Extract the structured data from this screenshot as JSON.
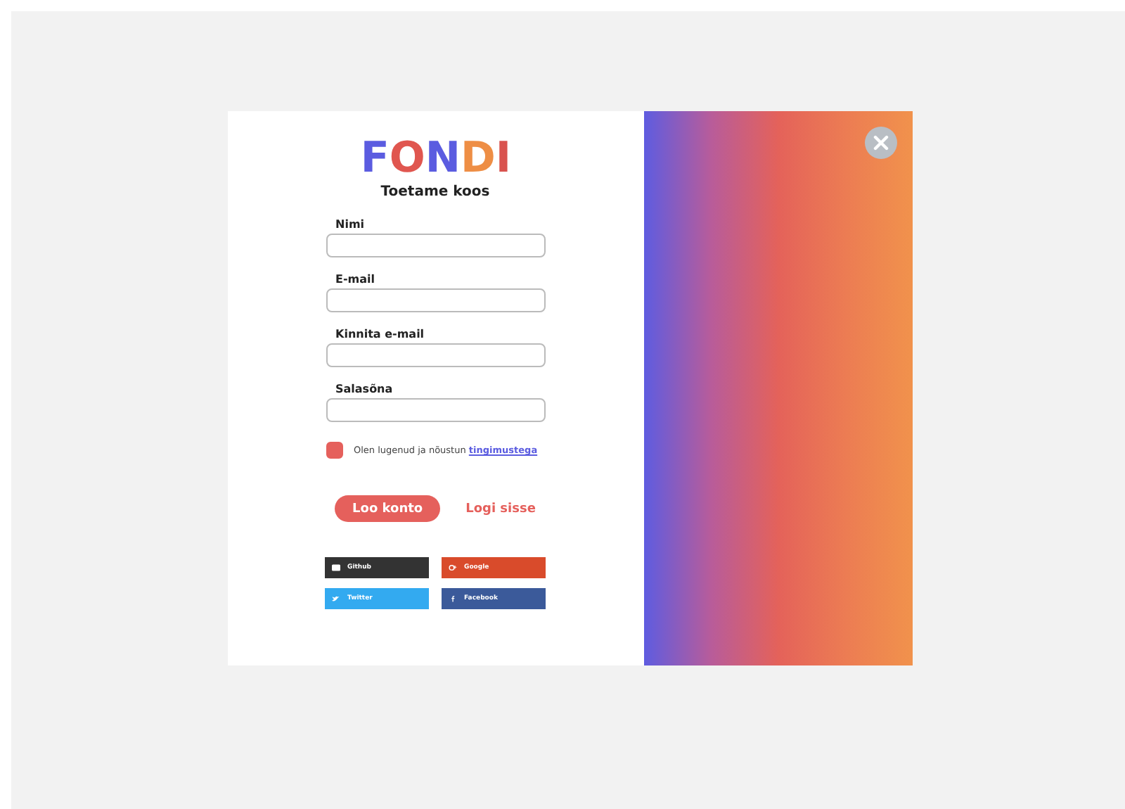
{
  "logo": {
    "letters": [
      "F",
      "O",
      "N",
      "D",
      "I"
    ]
  },
  "tagline": "Toetame koos",
  "fields": [
    {
      "label": "Nimi"
    },
    {
      "label": "E-mail"
    },
    {
      "label": "Kinnita e-mail"
    },
    {
      "label": "Salasõna"
    }
  ],
  "terms": {
    "checked": true,
    "text": "Olen lugenud ja nõustun ",
    "link": "tingimustega"
  },
  "buttons": {
    "primary": "Loo konto",
    "secondary": "Logi sisse"
  },
  "social": [
    {
      "kind": "github",
      "label": "Github"
    },
    {
      "kind": "google",
      "label": "Google"
    },
    {
      "kind": "twitter",
      "label": "Twitter"
    },
    {
      "kind": "facebook",
      "label": "Facebook"
    }
  ]
}
